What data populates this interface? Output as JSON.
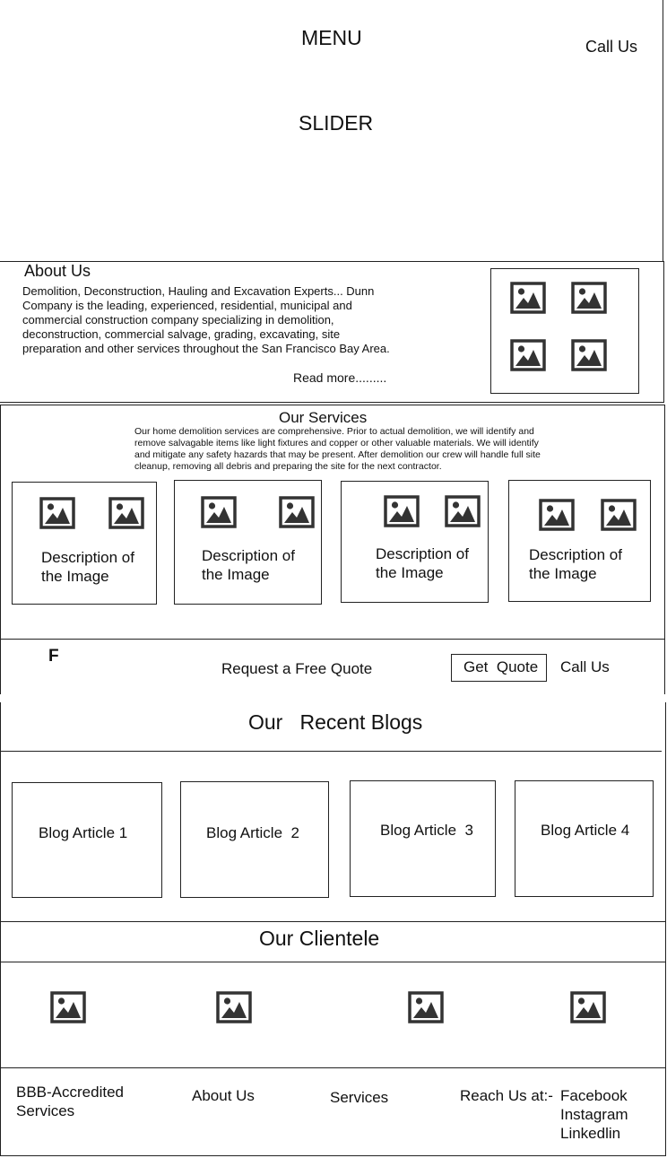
{
  "header": {
    "menu_label": "MENU",
    "call_us_label": "Call Us",
    "slider_label": "SLIDER"
  },
  "about": {
    "heading": "About Us",
    "paragraph": "Demolition, Deconstruction, Hauling and Excavation Experts... Dunn Company is the leading, experienced, residential, municipal and commercial construction company specializing in demolition, deconstruction, commercial salvage, grading, excavating, site preparation and other services throughout the San Francisco Bay Area.",
    "read_more": "Read more.........",
    "image_icon": "image-placeholder-icon"
  },
  "services": {
    "heading": "Our Services",
    "paragraph": "Our home demolition services are comprehensive. Prior to actual demolition, we will identify and remove salvagable items like light fixtures and copper or other valuable materials. We will identify and mitigate any safety hazards that may be present. After demolition our crew will handle full site cleanup, removing all debris and preparing the site for the next contractor.",
    "cards": [
      {
        "description": "Description of\nthe Image"
      },
      {
        "description": "Description of\nthe Image"
      },
      {
        "description": "Description of\nthe Image"
      },
      {
        "description": "Description of\nthe Image"
      }
    ]
  },
  "quote_bar": {
    "logo_letter": "F",
    "request_text": "Request a Free Quote",
    "get_quote_button": "Get  Quote",
    "call_us_label": "Call Us"
  },
  "blogs": {
    "heading": "Our   Recent Blogs",
    "articles": [
      "Blog Article 1",
      "Blog Article  2",
      "Blog Article  3",
      "Blog Article 4"
    ]
  },
  "clientele": {
    "heading": "Our Clientele"
  },
  "footer": {
    "bbb": "BBB-Accredited\nServices",
    "about": "About Us",
    "services": "Services",
    "reach_label": "Reach Us at:-",
    "social": [
      "Facebook",
      "Instagram",
      "Linkedlin"
    ]
  }
}
